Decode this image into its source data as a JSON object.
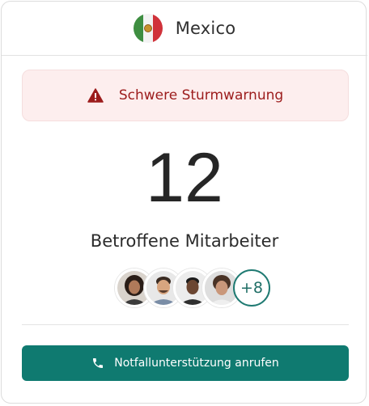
{
  "header": {
    "country": "Mexico",
    "flag_icon": "mexico-flag-icon"
  },
  "alert": {
    "icon": "warning-triangle-icon",
    "text": "Schwere Sturmwarnung",
    "color": "#9c1c1c",
    "background": "#fdeeee"
  },
  "stats": {
    "count": "12",
    "label": "Betroffene Mitarbeiter"
  },
  "avatars": {
    "people": [
      {
        "name": "avatar-1"
      },
      {
        "name": "avatar-2"
      },
      {
        "name": "avatar-3"
      },
      {
        "name": "avatar-4"
      }
    ],
    "more_label": "+8"
  },
  "action": {
    "icon": "phone-icon",
    "label": "Notfallunterstützung anrufen",
    "color": "#0f7a70"
  }
}
